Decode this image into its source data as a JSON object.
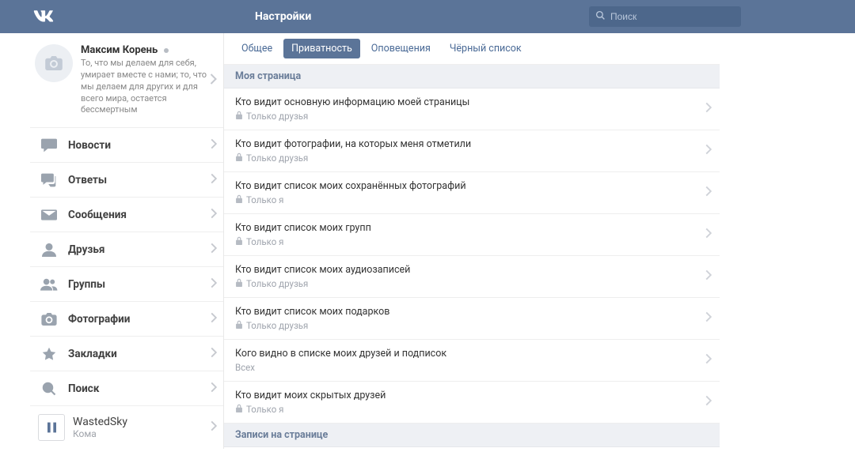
{
  "header": {
    "title": "Настройки",
    "search_placeholder": "Поиск"
  },
  "profile": {
    "name": "Максим Корень",
    "desc": "То, что мы делаем для себя, умирает вместе с нами; то, что мы делаем для других и для всего мира, остается бессмертным"
  },
  "nav": {
    "news": "Новости",
    "replies": "Ответы",
    "messages": "Сообщения",
    "friends": "Друзья",
    "groups": "Группы",
    "photos": "Фотографии",
    "bookmarks": "Закладки",
    "search": "Поиск"
  },
  "player": {
    "track": "WastedSky",
    "artist": "Кома"
  },
  "tabs": {
    "general": "Общее",
    "privacy": "Приватность",
    "notifications": "Оповещения",
    "blacklist": "Чёрный список"
  },
  "sections": {
    "my_page": "Моя страница",
    "wall": "Записи на странице"
  },
  "settings": [
    {
      "label": "Кто видит основную информацию моей страницы",
      "value": "Только друзья",
      "locked": true
    },
    {
      "label": "Кто видит фотографии, на которых меня отметили",
      "value": "Только друзья",
      "locked": true
    },
    {
      "label": "Кто видит список моих сохранённых фотографий",
      "value": "Только я",
      "locked": true
    },
    {
      "label": "Кто видит список моих групп",
      "value": "Только я",
      "locked": true
    },
    {
      "label": "Кто видит список моих аудиозаписей",
      "value": "Только друзья",
      "locked": true
    },
    {
      "label": "Кто видит список моих подарков",
      "value": "Только друзья",
      "locked": true
    },
    {
      "label": "Кого видно в списке моих друзей и подписок",
      "value": "Всех",
      "locked": false
    },
    {
      "label": "Кто видит моих скрытых друзей",
      "value": "Только я",
      "locked": true
    }
  ]
}
